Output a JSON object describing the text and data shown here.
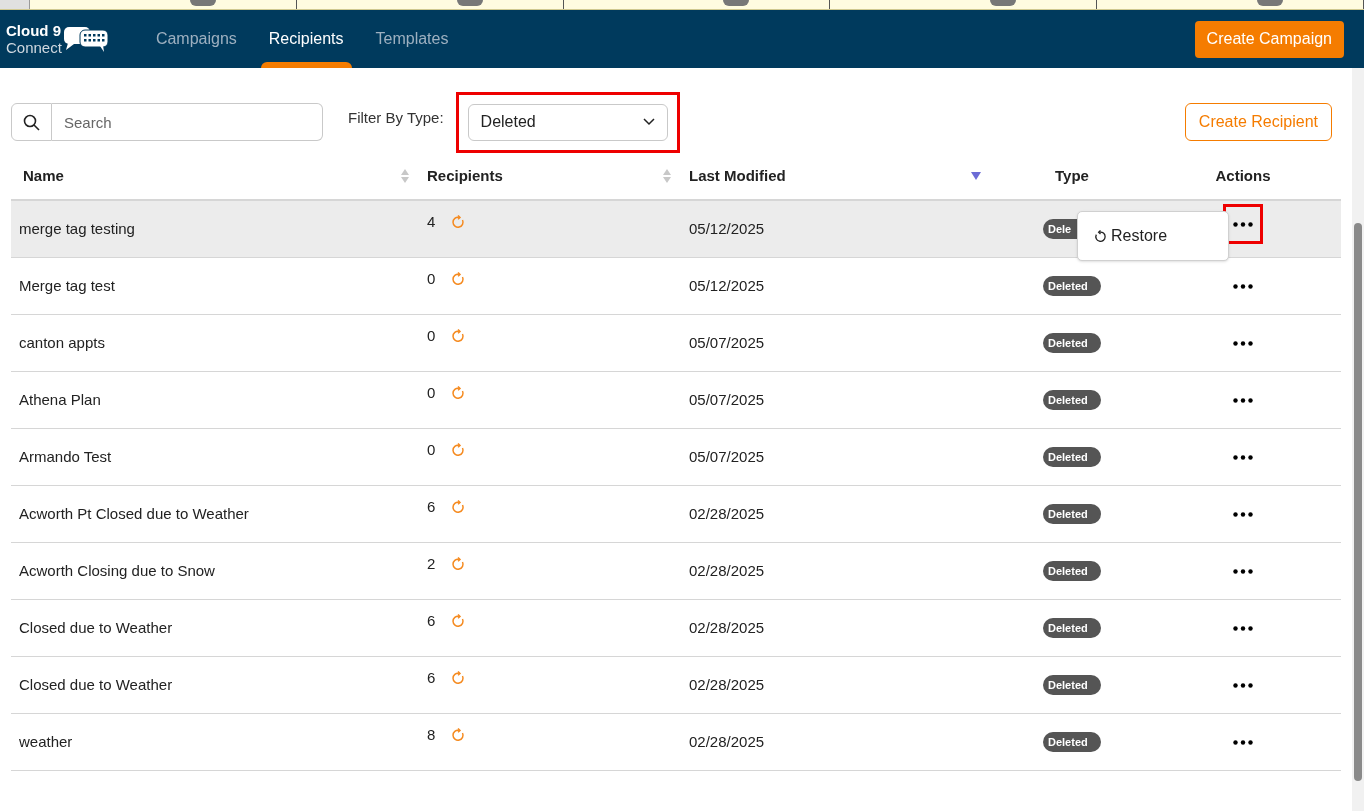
{
  "brand": {
    "line1": "Cloud 9",
    "line2": "Connect"
  },
  "nav": [
    {
      "label": "Campaigns",
      "selected": false
    },
    {
      "label": "Recipients",
      "selected": true
    },
    {
      "label": "Templates",
      "selected": false
    }
  ],
  "create_campaign": "Create Campaign",
  "search": {
    "placeholder": "Search"
  },
  "filter": {
    "label": "Filter By Type:",
    "value": "Deleted",
    "highlighted": true
  },
  "create_recipient": "Create Recipient",
  "columns": [
    {
      "label": "Name",
      "sort_active": false
    },
    {
      "label": "Recipients",
      "sort_active": false
    },
    {
      "label": "Last Modified",
      "sort_active": true
    },
    {
      "label": "Type"
    },
    {
      "label": "Actions"
    }
  ],
  "rows": [
    {
      "name": "merge tag testing",
      "count": "4",
      "date": "05/12/2025",
      "type": "Dele",
      "selected": true,
      "menu": {
        "item": "Restore"
      }
    },
    {
      "name": "Merge tag test",
      "count": "0",
      "date": "05/12/2025",
      "type": "Deleted",
      "selected": false
    },
    {
      "name": "canton appts",
      "count": "0",
      "date": "05/07/2025",
      "type": "Deleted",
      "selected": false
    },
    {
      "name": "Athena Plan",
      "count": "0",
      "date": "05/07/2025",
      "type": "Deleted",
      "selected": false
    },
    {
      "name": "Armando Test",
      "count": "0",
      "date": "05/07/2025",
      "type": "Deleted",
      "selected": false
    },
    {
      "name": "Acworth Pt Closed due to Weather",
      "count": "6",
      "date": "02/28/2025",
      "type": "Deleted",
      "selected": false
    },
    {
      "name": "Acworth Closing due to Snow",
      "count": "2",
      "date": "02/28/2025",
      "type": "Deleted",
      "selected": false
    },
    {
      "name": "Closed due to Weather",
      "count": "6",
      "date": "02/28/2025",
      "type": "Deleted",
      "selected": false
    },
    {
      "name": "Closed due to Weather",
      "count": "6",
      "date": "02/28/2025",
      "type": "Deleted",
      "selected": false
    },
    {
      "name": "weather",
      "count": "8",
      "date": "02/28/2025",
      "type": "Deleted",
      "selected": false
    }
  ]
}
